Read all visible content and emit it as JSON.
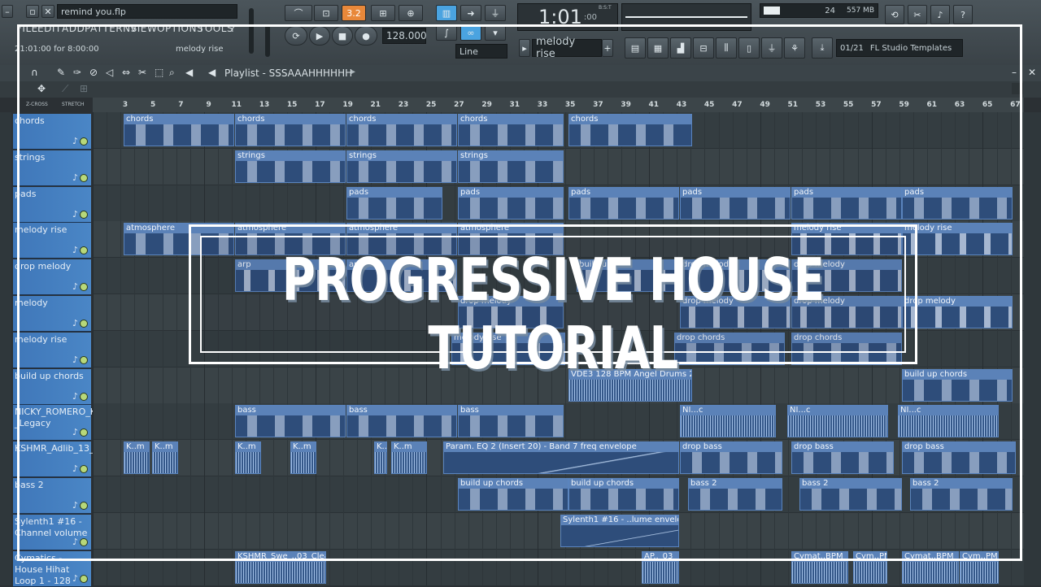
{
  "window": {
    "file_name": "remind you.flp",
    "hint_text": "21:01:00 for 8:00:00",
    "hint_pattern": "melody rise"
  },
  "menu": [
    "FILE",
    "EDIT",
    "ADD",
    "PATTERNS",
    "VIEW",
    "OPTIONS",
    "TOOLS",
    "?"
  ],
  "transport": {
    "tempo": "128.000",
    "time": "1:01",
    "time_small": ":00",
    "time_label": "B:S:T",
    "mode_indicator": "3.2",
    "memory": "557 MB",
    "cpu_num": "24",
    "snap_mode": "Line",
    "pattern": "melody rise",
    "template_counter": "01/21",
    "template_name": "FL Studio Templates"
  },
  "playlist": {
    "title": "Playlist - SSSAAAHHHHHH",
    "zcross_label": "Z-CROSS",
    "stretch_label": "STRETCH",
    "ruler_ticks": [
      "3",
      "5",
      "7",
      "9",
      "11",
      "13",
      "15",
      "17",
      "19",
      "21",
      "23",
      "25",
      "27",
      "29",
      "31",
      "33",
      "35",
      "37",
      "39",
      "41",
      "43",
      "45",
      "47",
      "49",
      "51",
      "53",
      "55",
      "57",
      "59",
      "61",
      "63",
      "65",
      "67"
    ]
  },
  "tracks": [
    {
      "name": "chords"
    },
    {
      "name": "strings"
    },
    {
      "name": "pads"
    },
    {
      "name": "melody rise"
    },
    {
      "name": "drop melody"
    },
    {
      "name": "melody"
    },
    {
      "name": "melody rise"
    },
    {
      "name": "build up chords"
    },
    {
      "name": "NICKY_ROMERO_Kick _Legacy"
    },
    {
      "name": "KSHMR_Adlib_13_Em"
    },
    {
      "name": "bass 2"
    },
    {
      "name": "Sylenth1 #16 - Channel volume"
    },
    {
      "name": "Cymatics - House Hihat Loop 1 - 128"
    }
  ],
  "clips": {
    "chords": "chords",
    "strings": "strings",
    "pads": "pads",
    "atmosphere": "atmosphere",
    "arp": "arp",
    "build_up": "build up",
    "drop_melody": "drop melody",
    "melody_rise": "melody rise",
    "drop_chords": "drop chords",
    "vdes": "VDE3 128 BPM Angel Drums 2",
    "build_up_chords": "build up chords",
    "bass": "bass",
    "ni": "NI...c",
    "k_m": "K..m",
    "param_eq": "Param. EQ 2 (Insert 20) - Band 7 freq envelope",
    "drop_bass": "drop bass",
    "bass2": "bass 2",
    "sylenth_env": "Sylenth1 #16 - ..lume envelope",
    "kshmr": "KSHMR_Swe_..03_Clean",
    "ap": "AP.._03",
    "cymat": "Cymat..BPM",
    "cym_pm": "Cym..PM"
  },
  "overlay": {
    "title": "PROGRESSIVE HOUSE TUTORIAL"
  }
}
